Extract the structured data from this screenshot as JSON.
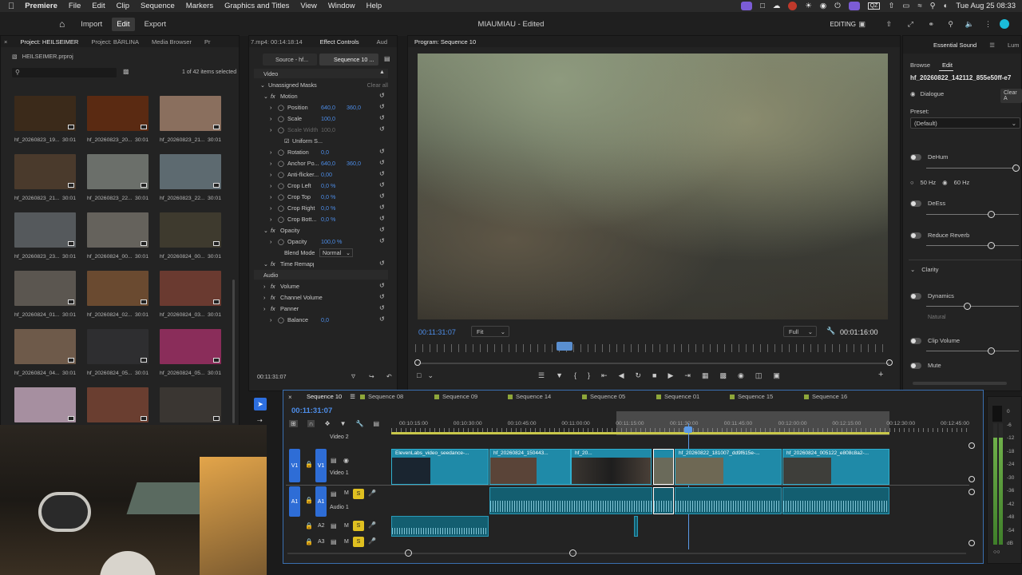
{
  "menubar": {
    "apple": "",
    "app": "Premiere",
    "items": [
      "File",
      "Edit",
      "Clip",
      "Sequence",
      "Markers",
      "Graphics and Titles",
      "View",
      "Window",
      "Help"
    ],
    "tray_text": "QZ",
    "clock": "Tue Aug 25  08:33"
  },
  "topbar": {
    "home_icon": "home-icon",
    "workspaces": [
      "Import",
      "Edit",
      "Export"
    ],
    "active_workspace": "Edit",
    "title": "MIAUMIAU - Edited",
    "mode": "EDITING"
  },
  "project": {
    "tabs": [
      "Project: HEILSEIMER",
      "Project: BÄRLINA",
      "Media Browser",
      "Pr"
    ],
    "file": "HEILSEIMER.prproj",
    "selection_info": "1 of 42 items selected",
    "search_placeholder": "",
    "thumbnails": [
      {
        "name": "hf_20260823_19...",
        "dur": "30:01",
        "color": "#3b2a1a"
      },
      {
        "name": "hf_20260823_20...",
        "dur": "30:01",
        "color": "#5a2a12"
      },
      {
        "name": "hf_20260823_21...",
        "dur": "30:01",
        "color": "#8a6f5e"
      },
      {
        "name": "hf_20260823_21...",
        "dur": "30:01",
        "color": "#4a3a2c"
      },
      {
        "name": "hf_20260823_22...",
        "dur": "30:01",
        "color": "#6b6f6a"
      },
      {
        "name": "hf_20260823_22...",
        "dur": "30:01",
        "color": "#5d6a70"
      },
      {
        "name": "hf_20260823_23...",
        "dur": "30:01",
        "color": "#55595c"
      },
      {
        "name": "hf_20260824_00...",
        "dur": "30:01",
        "color": "#65625c"
      },
      {
        "name": "hf_20260824_00...",
        "dur": "30:01",
        "color": "#3e3a2e"
      },
      {
        "name": "hf_20260824_01...",
        "dur": "30:01",
        "color": "#5b5650"
      },
      {
        "name": "hf_20260824_02...",
        "dur": "30:01",
        "color": "#6a4a30"
      },
      {
        "name": "hf_20260824_03...",
        "dur": "30:01",
        "color": "#6a3a30"
      },
      {
        "name": "hf_20260824_04...",
        "dur": "30:01",
        "color": "#6e5a4a"
      },
      {
        "name": "hf_20260824_05...",
        "dur": "30:01",
        "color": "#2e2e30"
      },
      {
        "name": "hf_20260824_05...",
        "dur": "30:01",
        "color": "#8a2d5a"
      },
      {
        "name": "",
        "dur": "",
        "color": "#a68fa0"
      },
      {
        "name": "",
        "dur": "",
        "color": "#6a3e30"
      },
      {
        "name": "",
        "dur": "",
        "color": "#3a3632"
      }
    ]
  },
  "effect_controls": {
    "tabs": [
      "7.mp4: 00:14:18:14",
      "Effect Controls",
      "Aud"
    ],
    "source_btn": "Source - hf...",
    "sequence_btn": "Sequence 10 ...",
    "section_video": "Video",
    "unassigned_masks": "Unassigned Masks",
    "clear_all": "Clear all",
    "rows": [
      {
        "label": "Motion",
        "v1": "",
        "v2": "",
        "fx": true,
        "indent": 0
      },
      {
        "label": "Position",
        "v1": "640,0",
        "v2": "360,0",
        "fx": false,
        "indent": 1
      },
      {
        "label": "Scale",
        "v1": "100,0",
        "v2": "",
        "fx": false,
        "indent": 1
      },
      {
        "label": "Scale Width",
        "v1": "100,0",
        "v2": "",
        "fx": false,
        "indent": 1,
        "dim": true
      },
      {
        "label": "Uniform S...",
        "v1": "",
        "v2": "",
        "fx": false,
        "indent": 2,
        "check": true
      },
      {
        "label": "Rotation",
        "v1": "0,0",
        "v2": "",
        "fx": false,
        "indent": 1
      },
      {
        "label": "Anchor Po...",
        "v1": "640,0",
        "v2": "360,0",
        "fx": false,
        "indent": 1
      },
      {
        "label": "Anti-flicker...",
        "v1": "0,00",
        "v2": "",
        "fx": false,
        "indent": 1
      },
      {
        "label": "Crop Left",
        "v1": "0,0 %",
        "v2": "",
        "fx": false,
        "indent": 1
      },
      {
        "label": "Crop Top",
        "v1": "0,0 %",
        "v2": "",
        "fx": false,
        "indent": 1
      },
      {
        "label": "Crop Right",
        "v1": "0,0 %",
        "v2": "",
        "fx": false,
        "indent": 1
      },
      {
        "label": "Crop Bott...",
        "v1": "0,0 %",
        "v2": "",
        "fx": false,
        "indent": 1
      },
      {
        "label": "Opacity",
        "v1": "",
        "v2": "",
        "fx": true,
        "indent": 0
      },
      {
        "label": "Opacity",
        "v1": "100,0 %",
        "v2": "",
        "fx": false,
        "indent": 1
      },
      {
        "label": "Blend Mode",
        "v1": "Normal",
        "v2": "",
        "fx": false,
        "indent": 2,
        "select": true
      },
      {
        "label": "Time Remapping",
        "v1": "",
        "v2": "",
        "fx": true,
        "indent": 0
      }
    ],
    "section_audio": "Audio",
    "audio_rows": [
      {
        "label": "Volume",
        "v1": ""
      },
      {
        "label": "Channel Volume",
        "v1": ""
      },
      {
        "label": "Panner",
        "v1": ""
      },
      {
        "label": "Balance",
        "v1": "0,0"
      }
    ],
    "timecode": "00:11:31:07"
  },
  "program": {
    "title": "Program: Sequence 10",
    "timecode": "00:11:31:07",
    "fit": "Fit",
    "quality": "Full",
    "duration": "00:01:16:00"
  },
  "essential_sound": {
    "tab": "Essential Sound",
    "tab2": "Lum",
    "browse": "Browse",
    "edit": "Edit",
    "clip_name": "hf_20260822_142112_855e50ff-e7",
    "type": "Dialogue",
    "clear": "Clear A",
    "preset_label": "Preset:",
    "preset_value": "(Default)",
    "dehum": "DeHum",
    "hz50": "50 Hz",
    "hz60": "60 Hz",
    "dess": "DeEss",
    "reduce_reverb": "Reduce Reverb",
    "clarity": "Clarity",
    "dynamics": "Dynamics",
    "natural": "Natural",
    "clip_volume": "Clip Volume",
    "mute": "Mute"
  },
  "timeline": {
    "tabs": [
      "Sequence 10",
      "Sequence 08",
      "Sequence 09",
      "Sequence 14",
      "Sequence 05",
      "Sequence 01",
      "Sequence 15",
      "Sequence 16"
    ],
    "timecode": "00:11:31:07",
    "ruler": [
      "00:10:15:00",
      "00:10:30:00",
      "00:10:45:00",
      "00:11:00:00",
      "00:11:15:00",
      "00:11:30:00",
      "00:11:45:00",
      "00:12:00:00",
      "00:12:15:00",
      "00:12:30:00",
      "00:12:45:00"
    ],
    "tracks": {
      "v2": "Video 2",
      "v1": "Video 1",
      "a1": "Audio 1",
      "v1_src": "V1",
      "v1_dst": "V1",
      "a1_src": "A1",
      "a1_dst": "A1",
      "a2": "A2",
      "a3": "A3",
      "m": "M",
      "s": "S"
    },
    "clips": [
      "ElevenLabs_video_seedance-...",
      "hf_20260824_150443...",
      "hf_20...",
      "hf_20260822_181007_dd9f615e-...",
      "hf_20260824_005122_e808c8a2-..."
    ]
  },
  "meter": {
    "ticks": [
      "0",
      "-6",
      "-12",
      "-18",
      "-24",
      "-30",
      "-36",
      "-42",
      "-48",
      "-54",
      "dB"
    ]
  }
}
